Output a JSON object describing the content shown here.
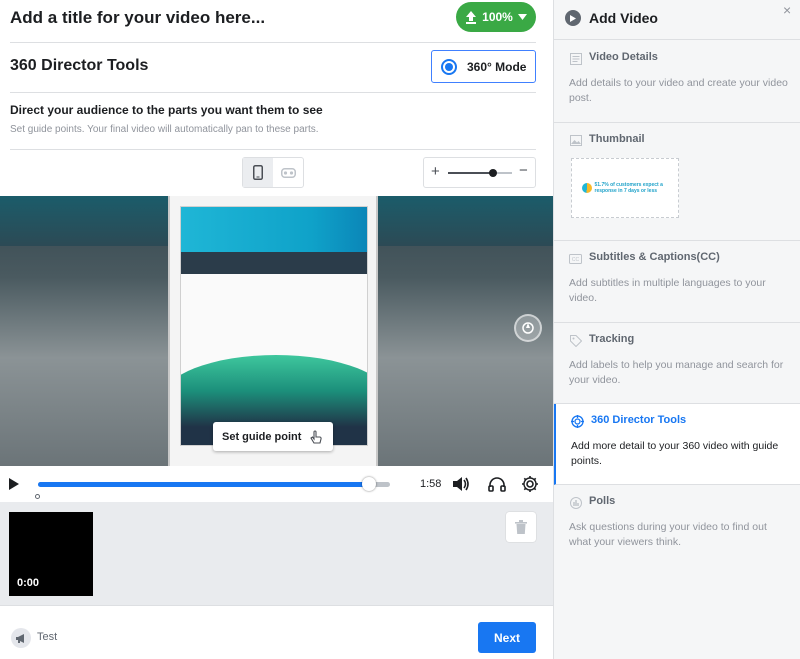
{
  "header": {
    "video_title_placeholder": "Add a title for your video here...",
    "upload_label": "100%"
  },
  "director": {
    "title": "360 Director Tools",
    "mode_label": "360° Mode",
    "headline": "Direct your audience to the parts you want them to see",
    "subtext": "Set guide points. Your final video will automatically pan to these parts."
  },
  "view_toggle": {
    "selected": "phone",
    "options": [
      "phone-icon",
      "vr-headset-icon"
    ]
  },
  "zoom": {
    "plus": "+",
    "minus": "−",
    "level": 0.7
  },
  "video": {
    "guide_point_label": "Set guide point"
  },
  "player": {
    "time": "1:58",
    "progress": 0.94
  },
  "timeline": {
    "clip_time": "0:00"
  },
  "footer": {
    "test_label": "Test",
    "next_label": "Next"
  },
  "sidebar": {
    "title": "Add Video",
    "close": "×",
    "sections": [
      {
        "title": "Video Details",
        "desc": "Add details to your video and create your video post.",
        "icon": "video-details-icon"
      },
      {
        "title": "Thumbnail",
        "desc": "",
        "icon": "image-icon",
        "thumb_text": "51.7% of customers expect a response in 7 days or less"
      },
      {
        "title": "Subtitles & Captions(CC)",
        "desc": "Add subtitles in multiple languages to your video.",
        "icon": "cc-icon"
      },
      {
        "title": "Tracking",
        "desc": "Add labels to help you manage and search for your video.",
        "icon": "tag-icon"
      },
      {
        "title": "360 Director Tools",
        "desc": "Add more detail to your 360 video with guide points.",
        "icon": "target-icon"
      },
      {
        "title": "Polls",
        "desc": "Ask questions during your video to find out what your viewers think.",
        "icon": "poll-icon"
      }
    ],
    "active_index": 4
  },
  "colors": {
    "accent": "#1877f2",
    "upload_green": "#3aa945",
    "sidebar_bg": "#f5f6f7"
  }
}
